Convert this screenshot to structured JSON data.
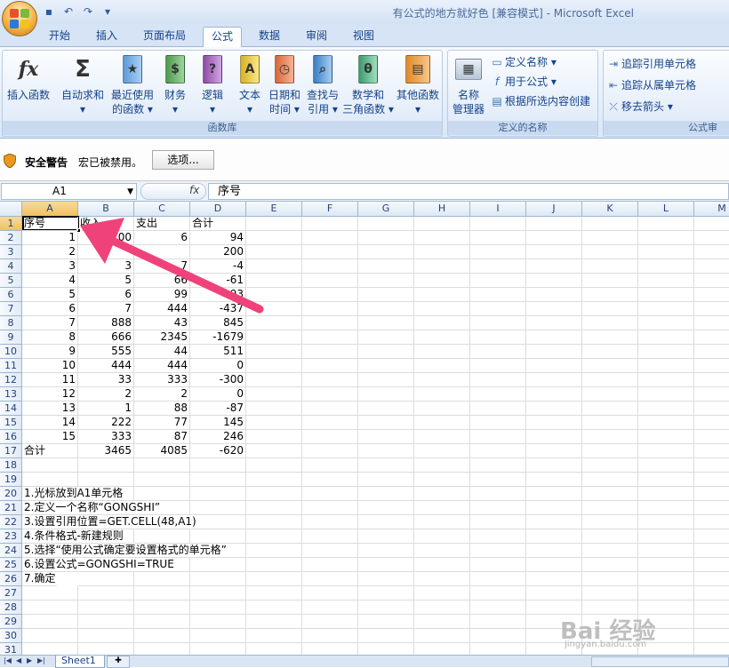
{
  "window": {
    "title": "有公式的地方就好色 [兼容模式] - Microsoft Excel"
  },
  "tabs": [
    "开始",
    "插入",
    "页面布局",
    "公式",
    "数据",
    "审阅",
    "视图"
  ],
  "active_tab": "公式",
  "ribbon": {
    "function_library": {
      "label": "函数库",
      "buttons": [
        {
          "line1": "插入函数",
          "line2": "",
          "icon": "fx-icon"
        },
        {
          "line1": "自动求和",
          "line2": "▾",
          "icon": "sigma-icon"
        },
        {
          "line1": "最近使用",
          "line2": "的函数 ▾",
          "icon": "recent-book-icon"
        },
        {
          "line1": "财务",
          "line2": "▾",
          "icon": "finance-book-icon"
        },
        {
          "line1": "逻辑",
          "line2": "▾",
          "icon": "logic-book-icon"
        },
        {
          "line1": "文本",
          "line2": "▾",
          "icon": "text-book-icon"
        },
        {
          "line1": "日期和",
          "line2": "时间 ▾",
          "icon": "datetime-book-icon"
        },
        {
          "line1": "查找与",
          "line2": "引用 ▾",
          "icon": "lookup-book-icon"
        },
        {
          "line1": "数学和",
          "line2": "三角函数 ▾",
          "icon": "math-book-icon"
        },
        {
          "line1": "其他函数",
          "line2": "▾",
          "icon": "more-book-icon"
        }
      ]
    },
    "defined_names": {
      "label": "定义的名称",
      "manager_line1": "名称",
      "manager_line2": "管理器",
      "define_name": "定义名称 ▾",
      "use_in_formula": "用于公式 ▾",
      "create_from_selection": "根据所选内容创建"
    },
    "formula_auditing": {
      "label": "公式审",
      "trace_precedents": "追踪引用单元格",
      "trace_dependents": "追踪从属单元格",
      "remove_arrows": "移去箭头 ▾"
    }
  },
  "message_bar": {
    "title": "安全警告",
    "text": "宏已被禁用。",
    "button": "选项..."
  },
  "formula_bar": {
    "name_box": "A1",
    "fx": "fx",
    "content": "序号"
  },
  "columns": [
    "A",
    "B",
    "C",
    "D",
    "E",
    "F",
    "G",
    "H",
    "I",
    "J",
    "K",
    "L",
    "M"
  ],
  "rows": [
    {
      "n": "1",
      "a": "序号",
      "b": "收入",
      "c": "支出",
      "d": "合计"
    },
    {
      "n": "2",
      "a": "1",
      "b": "100",
      "c": "6",
      "d": "94"
    },
    {
      "n": "3",
      "a": "2",
      "b": "",
      "c": "",
      "d": "200"
    },
    {
      "n": "4",
      "a": "3",
      "b": "3",
      "c": "7",
      "d": "-4"
    },
    {
      "n": "5",
      "a": "4",
      "b": "5",
      "c": "66",
      "d": "-61"
    },
    {
      "n": "6",
      "a": "5",
      "b": "6",
      "c": "99",
      "d": "-93"
    },
    {
      "n": "7",
      "a": "6",
      "b": "7",
      "c": "444",
      "d": "-437"
    },
    {
      "n": "8",
      "a": "7",
      "b": "888",
      "c": "43",
      "d": "845"
    },
    {
      "n": "9",
      "a": "8",
      "b": "666",
      "c": "2345",
      "d": "-1679"
    },
    {
      "n": "10",
      "a": "9",
      "b": "555",
      "c": "44",
      "d": "511"
    },
    {
      "n": "11",
      "a": "10",
      "b": "444",
      "c": "444",
      "d": "0"
    },
    {
      "n": "12",
      "a": "11",
      "b": "33",
      "c": "333",
      "d": "-300"
    },
    {
      "n": "13",
      "a": "12",
      "b": "2",
      "c": "2",
      "d": "0"
    },
    {
      "n": "14",
      "a": "13",
      "b": "1",
      "c": "88",
      "d": "-87"
    },
    {
      "n": "15",
      "a": "14",
      "b": "222",
      "c": "77",
      "d": "145"
    },
    {
      "n": "16",
      "a": "15",
      "b": "333",
      "c": "87",
      "d": "246"
    },
    {
      "n": "17",
      "a": "合计",
      "b": "3465",
      "c": "4085",
      "d": "-620"
    },
    {
      "n": "18",
      "a": "",
      "b": "",
      "c": "",
      "d": ""
    },
    {
      "n": "19",
      "a": "",
      "b": "",
      "c": "",
      "d": ""
    },
    {
      "n": "20",
      "a": "1.光标放到A1单元格",
      "b": "",
      "c": "",
      "d": ""
    },
    {
      "n": "21",
      "a": "2.定义一个名称“GONGSHI”",
      "b": "",
      "c": "",
      "d": ""
    },
    {
      "n": "22",
      "a": "3.设置引用位置=GET.CELL(48,A1)",
      "b": "",
      "c": "",
      "d": ""
    },
    {
      "n": "23",
      "a": "4.条件格式-新建规则",
      "b": "",
      "c": "",
      "d": ""
    },
    {
      "n": "24",
      "a": "5.选择“使用公式确定要设置格式的单元格”",
      "b": "",
      "c": "",
      "d": ""
    },
    {
      "n": "25",
      "a": "6.设置公式=GONGSHI=TRUE",
      "b": "",
      "c": "",
      "d": ""
    },
    {
      "n": "26",
      "a": "7.确定",
      "b": "",
      "c": "",
      "d": ""
    },
    {
      "n": "27",
      "a": "",
      "b": "",
      "c": "",
      "d": ""
    },
    {
      "n": "28",
      "a": "",
      "b": "",
      "c": "",
      "d": ""
    },
    {
      "n": "29",
      "a": "",
      "b": "",
      "c": "",
      "d": ""
    },
    {
      "n": "30",
      "a": "",
      "b": "",
      "c": "",
      "d": ""
    },
    {
      "n": "31",
      "a": "",
      "b": "",
      "c": "",
      "d": ""
    }
  ],
  "sheet_tab": "Sheet1",
  "watermark": {
    "main": "Bai 经验",
    "sub": "jingyan.baidu.com"
  },
  "colors": {
    "arrow": "#f0427a",
    "ribbon_text": "#15428b",
    "selected_header": "#f1c15f"
  }
}
